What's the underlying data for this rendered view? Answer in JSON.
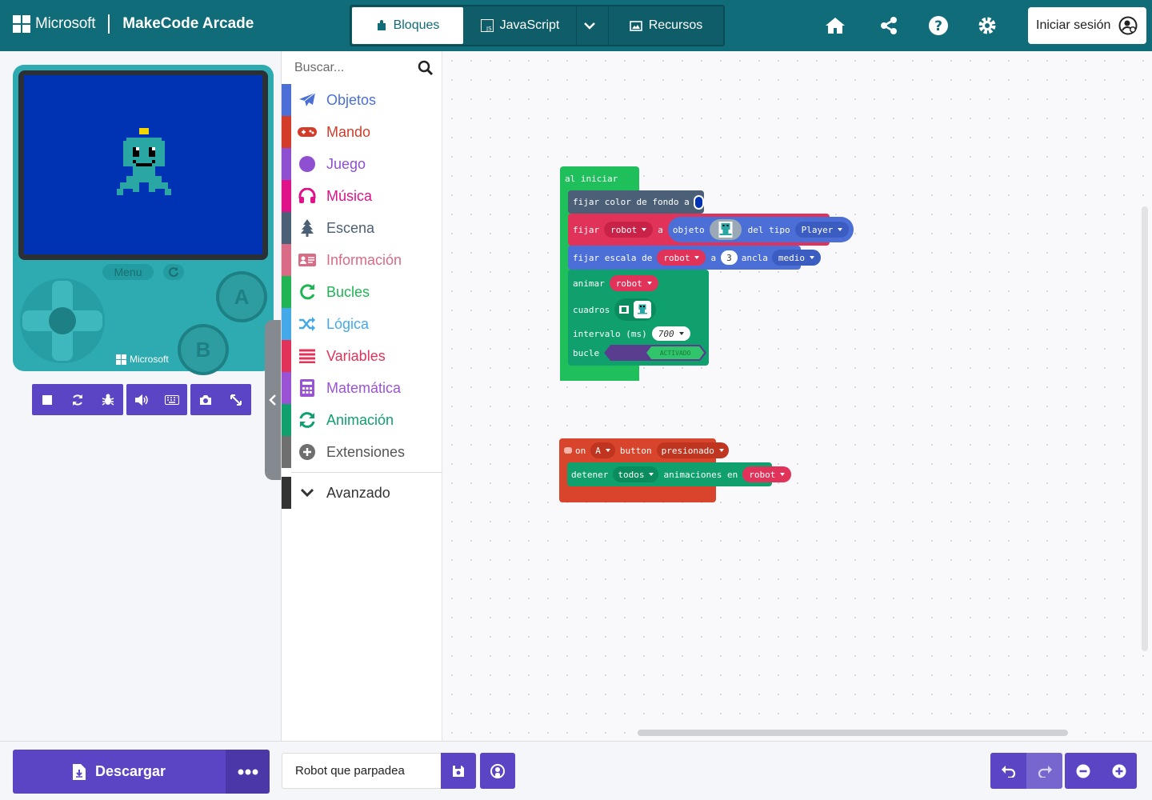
{
  "header": {
    "brand": "Microsoft",
    "app_title": "MakeCode Arcade",
    "tabs": [
      {
        "label": "Bloques",
        "icon": "puzzle-icon",
        "active": true
      },
      {
        "label": "JavaScript",
        "icon": "js-icon",
        "active": false
      },
      {
        "label": "Recursos",
        "icon": "image-icon",
        "active": false
      }
    ],
    "signin_label": "Iniciar sesión",
    "icons": [
      "home-icon",
      "share-icon",
      "help-icon",
      "settings-icon"
    ],
    "color": "#106c78"
  },
  "simulator": {
    "menu_label": "Menu",
    "button_a": "A",
    "button_b": "B",
    "device_brand": "Microsoft",
    "screen_color": "#0033b4",
    "toolbar": [
      "stop-icon",
      "restart-icon",
      "debug-icon",
      "sound-icon",
      "keyboard-icon",
      "screenshot-icon",
      "fullscreen-icon"
    ]
  },
  "toolbox": {
    "search_placeholder": "Buscar...",
    "categories": [
      {
        "label": "Objetos",
        "color": "#4b6fd6",
        "icon": "paper-plane-icon"
      },
      {
        "label": "Mando",
        "color": "#d33c28",
        "icon": "gamepad-icon"
      },
      {
        "label": "Juego",
        "color": "#8e4fd1",
        "icon": "circle-icon"
      },
      {
        "label": "Música",
        "color": "#e0128a",
        "icon": "headphones-icon"
      },
      {
        "label": "Escena",
        "color": "#4b6077",
        "icon": "tree-icon"
      },
      {
        "label": "Información",
        "color": "#d96b86",
        "icon": "id-card-icon"
      },
      {
        "label": "Bucles",
        "color": "#1fb454",
        "icon": "refresh-icon"
      },
      {
        "label": "Lógica",
        "color": "#44a9e8",
        "icon": "shuffle-icon"
      },
      {
        "label": "Variables",
        "color": "#e1335a",
        "icon": "list-icon"
      },
      {
        "label": "Matemática",
        "color": "#9a53d4",
        "icon": "calculator-icon"
      },
      {
        "label": "Animación",
        "color": "#0fa06d",
        "icon": "animation-refresh-icon"
      },
      {
        "label": "Extensiones",
        "color": "#6f6f6f",
        "icon": "plus-circle-icon"
      }
    ],
    "advanced": {
      "label": "Avanzado",
      "color": "#333333",
      "icon": "chevron-down-icon"
    }
  },
  "blocks": {
    "on_start": {
      "label": "al iniciar",
      "set_bg": {
        "label": "fijar color de fondo a",
        "value_color": "#0033b4"
      },
      "set_sprite": {
        "label": "fijar",
        "var": "robot",
        "to": "a",
        "sprite_label": "objeto",
        "kind_label": "del tipo",
        "kind": "Player"
      },
      "set_scale": {
        "label": "fijar escala de",
        "var": "robot",
        "to": "a",
        "value": "3",
        "anchor_label": "ancla",
        "anchor": "medio"
      },
      "animate": {
        "label": "animar",
        "var": "robot",
        "frames_label": "cuadros",
        "interval_label": "intervalo (ms)",
        "interval": "700",
        "loop_label": "bucle",
        "loop_value": "ACTIVADO"
      }
    },
    "on_button": {
      "on": "on",
      "button": "A",
      "button_label": "button",
      "event": "presionado",
      "stop": {
        "label": "detener",
        "which": "todos",
        "anim_label": "animaciones en",
        "var": "robot"
      }
    }
  },
  "footer": {
    "download_label": "Descargar",
    "project_name": "Robot que parpadea",
    "icons": [
      "save-icon",
      "github-icon",
      "undo-icon",
      "redo-icon",
      "zoom-out-icon",
      "zoom-in-icon"
    ]
  }
}
